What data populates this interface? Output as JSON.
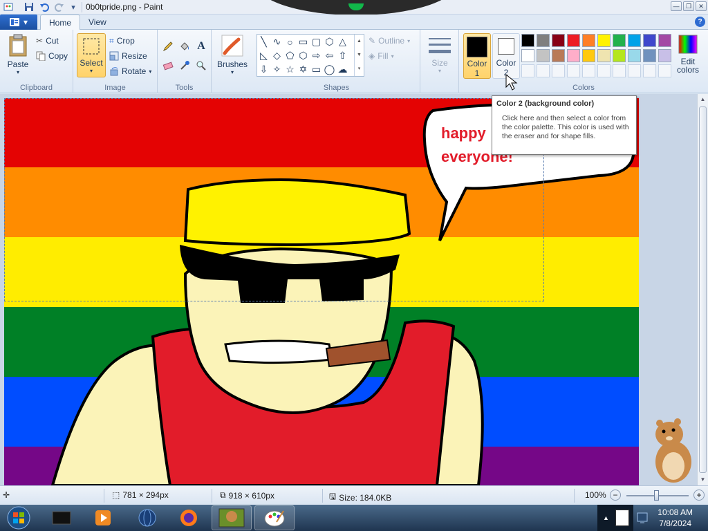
{
  "window": {
    "title": "0b0tpride.png - Paint"
  },
  "tabs": {
    "home": "Home",
    "view": "View"
  },
  "ribbon": {
    "clipboard": {
      "paste": "Paste",
      "cut": "Cut",
      "copy": "Copy",
      "label": "Clipboard"
    },
    "image": {
      "select": "Select",
      "crop": "Crop",
      "resize": "Resize",
      "rotate": "Rotate",
      "label": "Image"
    },
    "tools": {
      "label": "Tools"
    },
    "brushes": {
      "label": "Brushes"
    },
    "shapes": {
      "outline": "Outline",
      "fill": "Fill",
      "label": "Shapes"
    },
    "size": {
      "label": "Size"
    },
    "colors": {
      "color1_line1": "Color",
      "color1_line2": "1",
      "color2_line1": "Color",
      "color2_line2": "2",
      "edit_line1": "Edit",
      "edit_line2": "colors",
      "label": "Colors",
      "color1": "#000000",
      "color2": "#ffffff",
      "palette_row1": [
        "#000000",
        "#7f7f7f",
        "#880015",
        "#ed1c24",
        "#ff7f27",
        "#fff200",
        "#22b14c",
        "#00a2e8",
        "#3f48cc",
        "#a349a4"
      ],
      "palette_row2": [
        "#ffffff",
        "#c3c3c3",
        "#b97a57",
        "#ffaec9",
        "#ffc90e",
        "#efe4b0",
        "#b5e61d",
        "#99d9ea",
        "#7092be",
        "#c8bfe7"
      ]
    }
  },
  "canvas": {
    "speech_text_line1": "happy",
    "speech_text_line2": "everyone!",
    "flag_colors": [
      "#e40303",
      "#ff8c00",
      "#ffed00",
      "#008026",
      "#004dff",
      "#750787"
    ]
  },
  "tooltip": {
    "title": "Color 2 (background color)",
    "body": "Click here and then select a color from the color palette. This color is used with the eraser and for shape fills."
  },
  "status": {
    "selection_size": "781 × 294px",
    "image_size": "918 × 610px",
    "file_size": "Size: 184.0KB",
    "zoom": "100%"
  },
  "taskbar": {
    "time": "10:08 AM",
    "date": "7/8/2024"
  }
}
